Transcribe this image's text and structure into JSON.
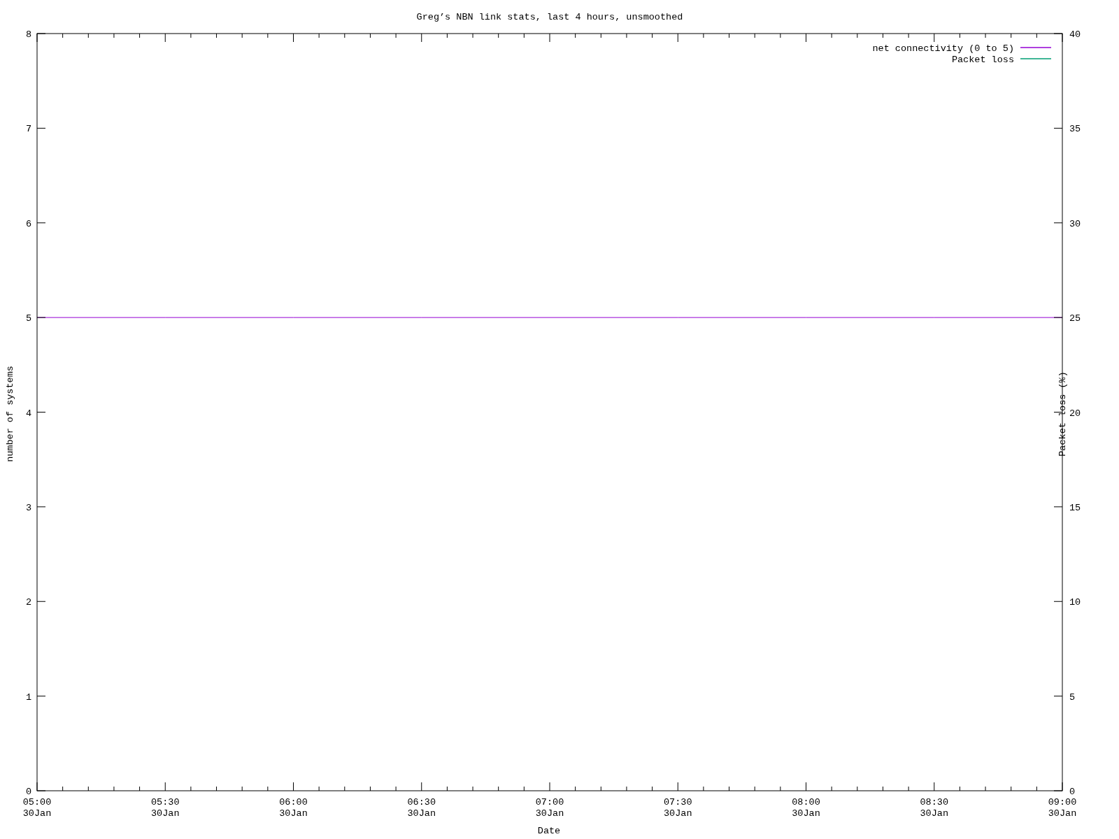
{
  "chart_data": {
    "type": "line",
    "title": "Greg’s NBN link stats, last 4 hours, unsmoothed",
    "xlabel": "Date",
    "ylabel": "number of systems",
    "y2label": "Packet loss (%)",
    "categories": [
      "05:00 30Jan",
      "05:30 30Jan",
      "06:00 30Jan",
      "06:30 30Jan",
      "07:00 30Jan",
      "07:30 30Jan",
      "08:00 30Jan",
      "08:30 30Jan",
      "09:00 30Jan"
    ],
    "series": [
      {
        "name": "net connectivity (0 to 5)",
        "color": "#9400d3",
        "axis": "y",
        "values": [
          5,
          5,
          5,
          5,
          5,
          5,
          5,
          5,
          5
        ]
      },
      {
        "name": "Packet loss",
        "color": "#009e73",
        "axis": "y2",
        "values": [
          null,
          null,
          null,
          null,
          null,
          null,
          null,
          null,
          null
        ]
      }
    ],
    "legend": true,
    "ylim": [
      0,
      8
    ],
    "y2lim": [
      0,
      40
    ],
    "yticks": [
      0,
      1,
      2,
      3,
      4,
      5,
      6,
      7,
      8
    ],
    "y2ticks": [
      0,
      5,
      10,
      15,
      20,
      25,
      30,
      35,
      40
    ]
  }
}
